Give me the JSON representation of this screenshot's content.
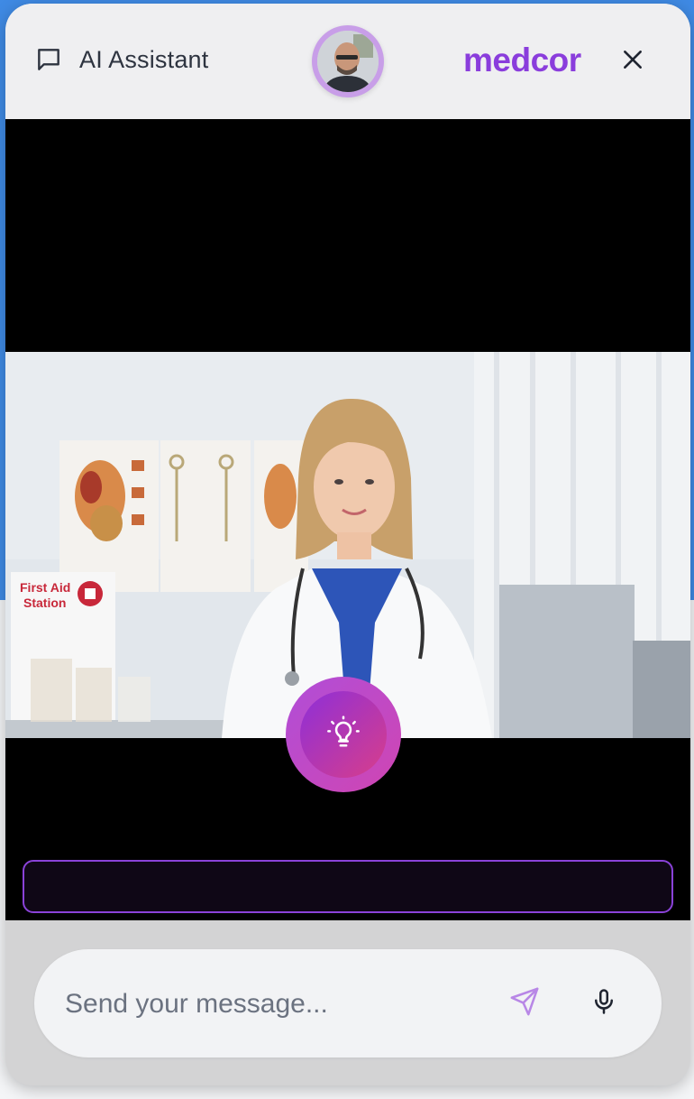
{
  "header": {
    "assistant_label": "AI Assistant",
    "brand": "medcor",
    "chat_icon": "chat-bubble-icon",
    "close_icon": "close-icon"
  },
  "avatar": {
    "description_icon": "user-avatar"
  },
  "video": {
    "poster_text_left": "First Aid",
    "poster_text_right": "Station",
    "idea_icon": "lightbulb-icon"
  },
  "input": {
    "placeholder": "Send your message...",
    "value": "",
    "send_icon": "send-icon",
    "mic_icon": "microphone-icon"
  },
  "colors": {
    "brand": "#8a3ddc",
    "accent_gradient_start": "#8e2fd8",
    "accent_gradient_end": "#d83e8a",
    "transcript_border": "#8a42d8",
    "send_icon": "#b887e6"
  }
}
